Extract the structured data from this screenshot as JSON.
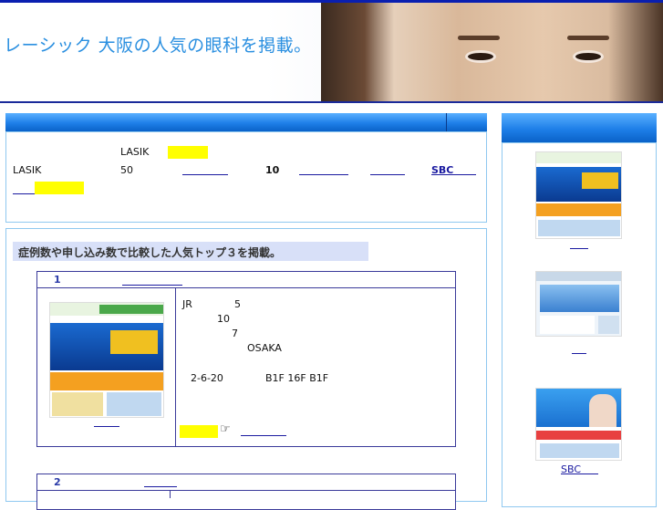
{
  "header": {
    "title": "レーシック 大阪の人気の眼科を掲載。"
  },
  "intro": {
    "line1_lasik": "LASIK",
    "line2_lasik": "LASIK",
    "line2_num50": "50",
    "line2_num10": "10",
    "line2_sbc": "SBC"
  },
  "ranking": {
    "callout": "症例数や申し込み数で比較した人気トップ３を掲載。",
    "item1": {
      "rank": "1",
      "detail_jr": "JR",
      "detail_5": "5",
      "detail_10": "10",
      "detail_7": "7",
      "detail_osaka": "OSAKA",
      "detail_address": "2-6-20",
      "detail_floors": "B1F 16F  B1F",
      "pointer_icon": "pointing-hand-icon"
    },
    "item2": {
      "rank": "2"
    }
  },
  "sidebar": {
    "items": [
      {
        "label": ""
      },
      {
        "label": ""
      },
      {
        "label": "SBC"
      }
    ]
  },
  "colors": {
    "accent_blue": "#1e7fe8",
    "highlight_yellow": "#ffff00",
    "border_navy": "#3a3a9a"
  }
}
